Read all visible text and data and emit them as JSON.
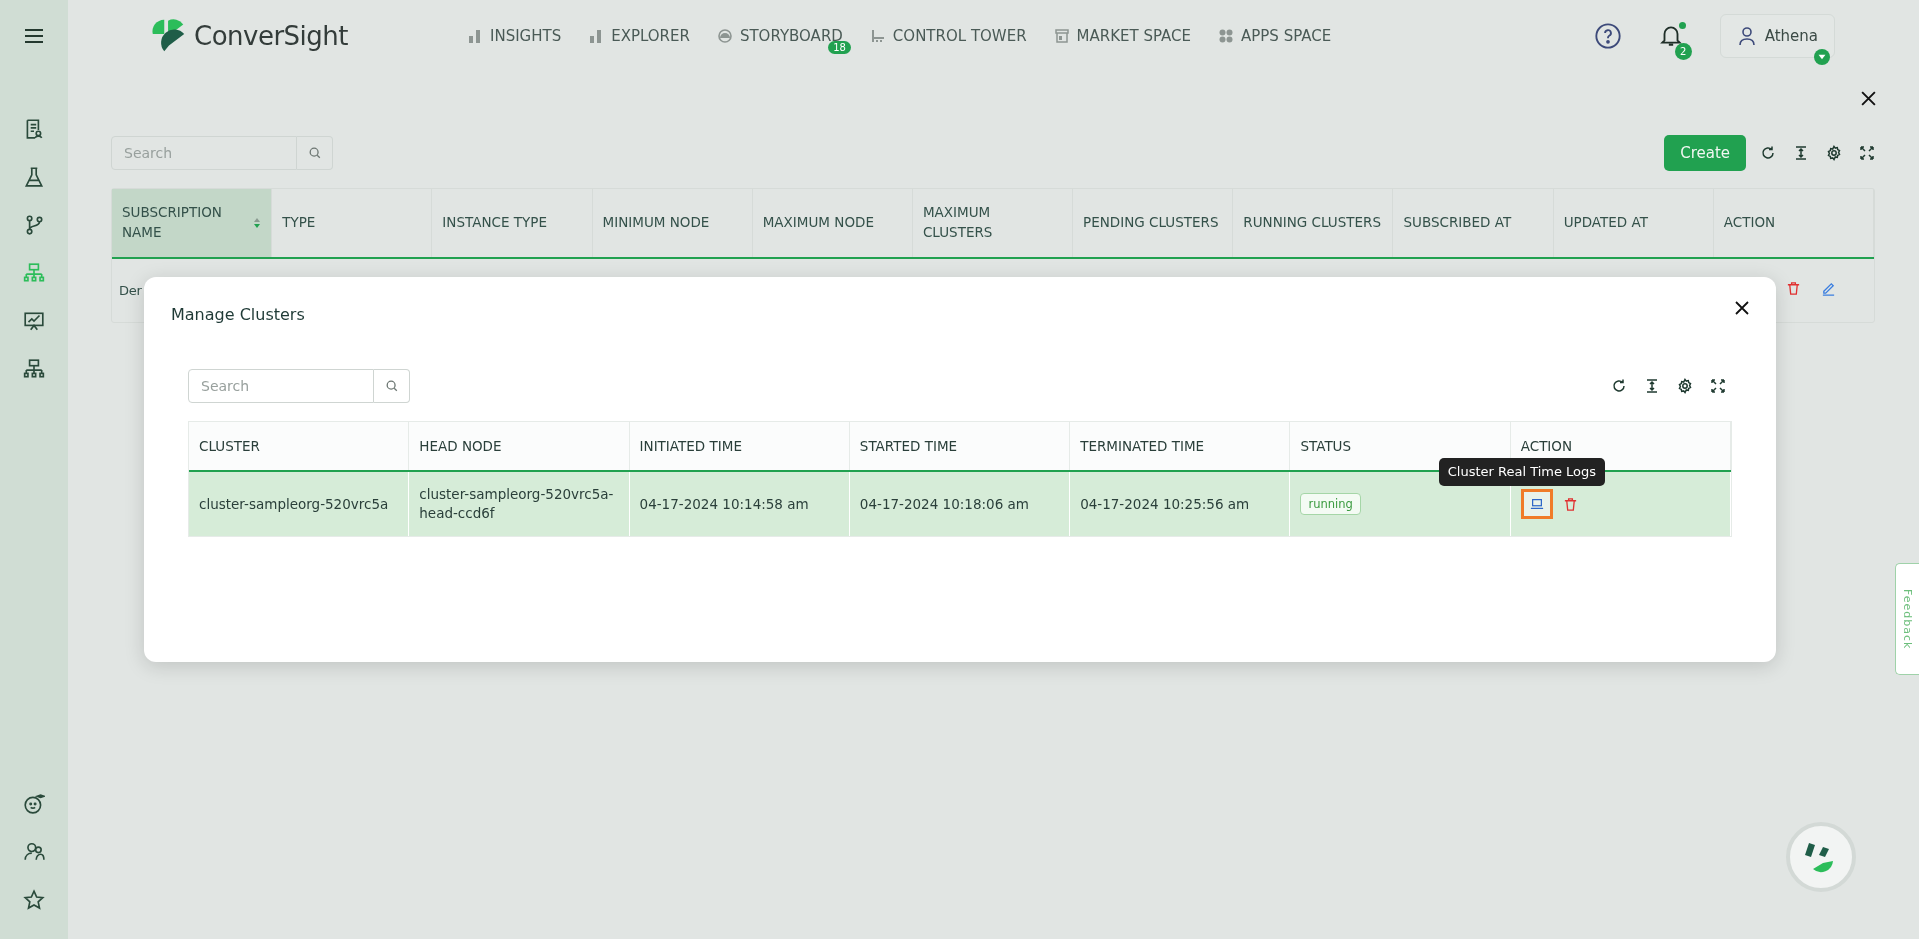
{
  "topbar": {
    "brand": "ConverSight",
    "nav": [
      {
        "label": "INSIGHTS",
        "kind": "bars"
      },
      {
        "label": "EXPLORER",
        "kind": "bars"
      },
      {
        "label": "STORYBOARD",
        "kind": "gauge",
        "badge": "18"
      },
      {
        "label": "CONTROL TOWER",
        "kind": "tower"
      },
      {
        "label": "MARKET SPACE",
        "kind": "store"
      },
      {
        "label": "APPS SPACE",
        "kind": "dots"
      }
    ],
    "notifications": "2",
    "unread": true,
    "user": "Athena"
  },
  "sidebar": {
    "items": [
      {
        "kind": "report",
        "selected": false
      },
      {
        "kind": "flask",
        "selected": false
      },
      {
        "kind": "branch",
        "selected": false
      },
      {
        "kind": "hierarchy",
        "selected": true
      },
      {
        "kind": "presentation",
        "selected": false
      },
      {
        "kind": "hierarchy",
        "selected": false
      }
    ],
    "bottom_items": [
      {
        "kind": "bot"
      },
      {
        "kind": "users"
      },
      {
        "kind": "star"
      }
    ]
  },
  "subscriptions": {
    "search": {
      "placeholder": "Search"
    },
    "create_button": "Create",
    "columns": [
      {
        "label": "SUBSCRIPTION NAME",
        "sorted": true
      },
      {
        "label": "TYPE",
        "sorted": false
      },
      {
        "label": "INSTANCE TYPE",
        "sorted": false
      },
      {
        "label": "MINIMUM NODE",
        "sorted": false
      },
      {
        "label": "MAXIMUM NODE",
        "sorted": false
      },
      {
        "label": "MAXIMUM CLUSTERS",
        "sorted": false
      },
      {
        "label": "PENDING CLUSTERS",
        "sorted": false
      },
      {
        "label": "RUNNING CLUSTERS",
        "sorted": false
      },
      {
        "label": "SUBSCRIBED AT",
        "sorted": false
      },
      {
        "label": "UPDATED AT",
        "sorted": false
      },
      {
        "label": "ACTION",
        "sorted": false
      }
    ],
    "rows": [
      {
        "name": "Der"
      }
    ]
  },
  "modal": {
    "title": "Manage Clusters",
    "search": {
      "placeholder": "Search"
    },
    "columns": [
      "CLUSTER",
      "HEAD NODE",
      "INITIATED TIME",
      "STARTED TIME",
      "TERMINATED TIME",
      "STATUS",
      "ACTION"
    ],
    "rows": [
      {
        "cluster": "cluster-sampleorg-520vrc5a",
        "head_node": "cluster-sampleorg-520vrc5a-head-ccd6f",
        "initiated": "04-17-2024 10:14:58 am",
        "started": "04-17-2024 10:18:06 am",
        "terminated": "04-17-2024 10:25:56 am",
        "status": "running",
        "selected": true,
        "logs_highlighted": true
      }
    ],
    "tooltip": "Cluster Real Time Logs"
  },
  "feedback": "Feedback"
}
